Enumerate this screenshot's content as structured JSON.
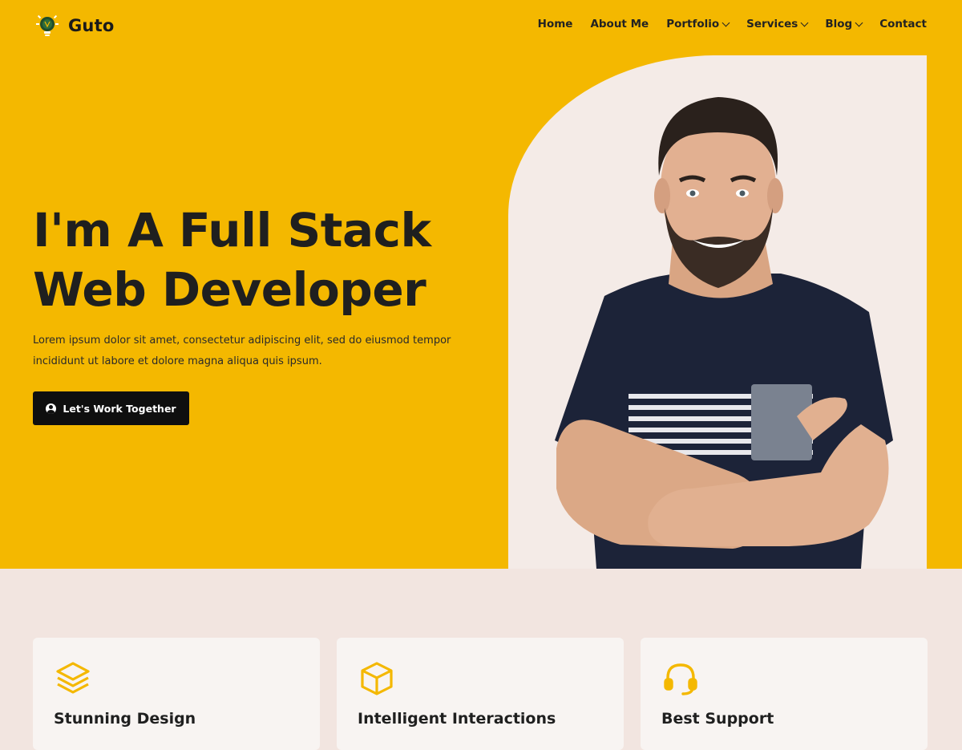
{
  "brand": {
    "name": "Guto"
  },
  "nav": {
    "items": [
      {
        "label": "Home",
        "dropdown": false
      },
      {
        "label": "About Me",
        "dropdown": false
      },
      {
        "label": "Portfolio",
        "dropdown": true
      },
      {
        "label": "Services",
        "dropdown": true
      },
      {
        "label": "Blog",
        "dropdown": true
      },
      {
        "label": "Contact",
        "dropdown": false
      }
    ]
  },
  "hero": {
    "title_line1": "I'm A Full Stack",
    "title_line2": "Web Developer",
    "description_line1": "Lorem ipsum dolor sit amet, consectetur adipiscing elit, sed do eiusmod tempor",
    "description_line2": "incididunt ut labore et dolore magna aliqua quis ipsum.",
    "cta_label": "Let's Work Together",
    "cta_icon": "user-circle-icon"
  },
  "features": [
    {
      "title": "Stunning Design",
      "icon": "layers-icon"
    },
    {
      "title": "Intelligent Interactions",
      "icon": "box-icon"
    },
    {
      "title": "Best Support",
      "icon": "headset-icon"
    }
  ],
  "colors": {
    "accent": "#f4b800",
    "dark": "#1f1f1f",
    "page_bg": "#f2e5e0",
    "card_bg": "#f8f4f2",
    "button_bg": "#0f0f0f"
  }
}
